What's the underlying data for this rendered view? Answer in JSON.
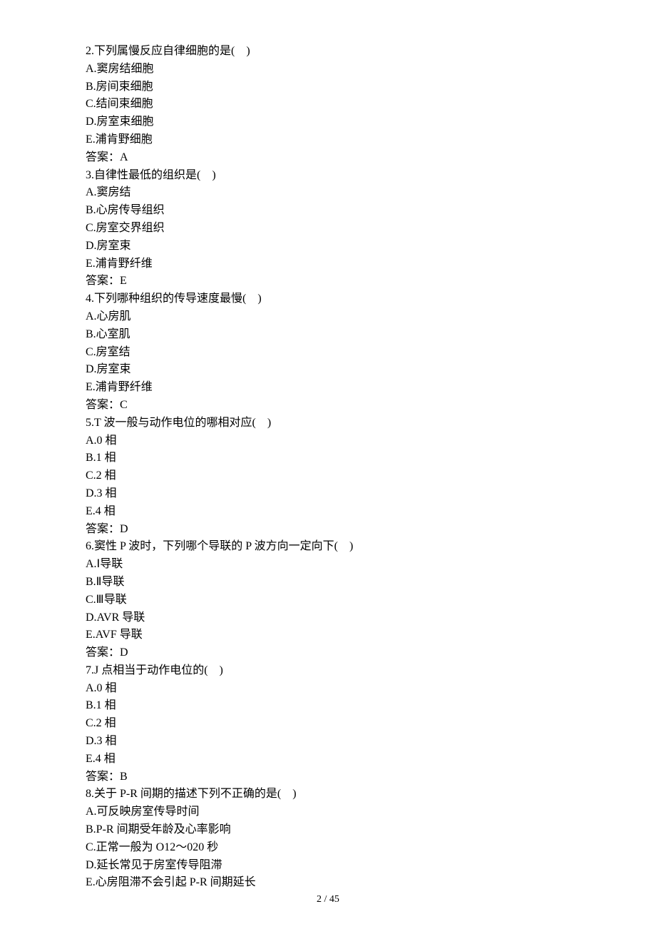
{
  "questions": [
    {
      "stem": "2.下列属慢反应自律细胞的是(　)",
      "options": [
        "A.窦房结细胞",
        "B.房间束细胞",
        "C.结间束细胞",
        "D.房室束细胞",
        "E.浦肯野细胞"
      ],
      "answer": "答案：A"
    },
    {
      "stem": "3.自律性最低的组织是(　)",
      "options": [
        "A.窦房结",
        "B.心房传导组织",
        "C.房室交界组织",
        "D.房室束",
        "E.浦肯野纤维"
      ],
      "answer": "答案：E"
    },
    {
      "stem": "4.下列哪种组织的传导速度最慢(　)",
      "options": [
        "A.心房肌",
        "B.心室肌",
        "C.房室结",
        "D.房室束",
        "E.浦肯野纤维"
      ],
      "answer": "答案：C"
    },
    {
      "stem": "5.T 波一般与动作电位的哪相对应(　)",
      "options": [
        "A.0 相",
        "B.1 相",
        "C.2 相",
        "D.3 相",
        "E.4 相"
      ],
      "answer": "答案：D"
    },
    {
      "stem": "6.窦性 P 波时，下列哪个导联的 P 波方向一定向下(　)",
      "options": [
        "A.Ⅰ导联",
        "B.Ⅱ导联",
        "C.Ⅲ导联",
        "D.AVR 导联",
        "E.AVF 导联"
      ],
      "answer": "答案：D"
    },
    {
      "stem": "7.J 点相当于动作电位的(　)",
      "options": [
        "A.0 相",
        "B.1 相",
        "C.2 相",
        "D.3 相",
        "E.4 相"
      ],
      "answer": "答案：B"
    },
    {
      "stem": "8.关于 P-R 间期的描述下列不正确的是(　)",
      "options": [
        "A.可反映房室传导时间",
        "B.P-R 间期受年龄及心率影响",
        "C.正常一般为 O12～020 秒",
        "D.延长常见于房室传导阻滞",
        "E.心房阻滞不会引起 P-R 间期延长"
      ],
      "answer": null
    }
  ],
  "footer": "2 / 45"
}
